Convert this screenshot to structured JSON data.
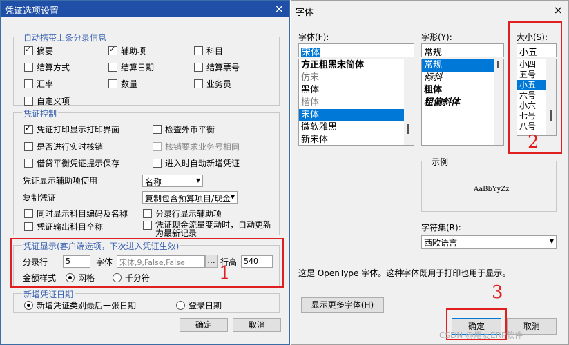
{
  "left_dialog": {
    "title": "凭证选项设置",
    "close_glyph": "×",
    "auto_group": {
      "legend": "自动携带上条分录信息",
      "items": [
        {
          "label": "摘要",
          "checked": true
        },
        {
          "label": "辅助项",
          "checked": true
        },
        {
          "label": "科目",
          "checked": false
        },
        {
          "label": "结算方式",
          "checked": false
        },
        {
          "label": "结算日期",
          "checked": false
        },
        {
          "label": "结算票号",
          "checked": false
        },
        {
          "label": "汇率",
          "checked": false
        },
        {
          "label": "数量",
          "checked": false
        },
        {
          "label": "业务员",
          "checked": false
        },
        {
          "label": "自定义项",
          "checked": false
        }
      ]
    },
    "control_group": {
      "legend": "凭证控制",
      "items": [
        {
          "label": "凭证打印显示打印界面",
          "checked": true
        },
        {
          "label": "检查外币平衡",
          "checked": false
        },
        {
          "label": "是否进行实时核销",
          "checked": false
        },
        {
          "label": "核销要求业务号相同",
          "checked": false,
          "disabled": true
        },
        {
          "label": "借贷平衡凭证提示保存",
          "checked": false
        },
        {
          "label": "进入时自动新增凭证",
          "checked": false
        }
      ],
      "aux_label": "凭证显示辅助项使用",
      "aux_value": "名称",
      "copy_label": "复制凭证",
      "copy_value": "复制包含预算项目/现金",
      "items2": [
        {
          "label": "同时显示科目编码及名称",
          "checked": false
        },
        {
          "label": "分录行显示辅助项",
          "checked": false
        },
        {
          "label": "凭证输出科目全称",
          "checked": false
        },
        {
          "label": "凭证现金流量变动时，自动更新为最新记录",
          "checked": false
        }
      ]
    },
    "display_group": {
      "legend": "凭证显示(客户端选项，下次进入凭证生效)",
      "rows_label": "分录行",
      "rows_value": "5",
      "font_label": "字体",
      "font_value": "宋体,9,False,False",
      "font_btn": "...",
      "height_label": "行高",
      "height_value": "540",
      "amount_label": "金额样式",
      "amount_options": [
        {
          "label": "网格",
          "checked": true
        },
        {
          "label": "千分符",
          "checked": false
        }
      ]
    },
    "date_group": {
      "legend": "新增凭证日期",
      "options": [
        {
          "label": "新增凭证类别最后一张日期",
          "checked": true
        },
        {
          "label": "登录日期",
          "checked": false
        }
      ]
    },
    "ok_label": "确定",
    "cancel_label": "取消",
    "annotation_1": "1"
  },
  "font_dialog": {
    "title": "字体",
    "close_glyph": "×",
    "font_label": "字体(F):",
    "font_value": "宋体",
    "fonts": [
      {
        "name": "方正粗黑宋简体",
        "selected": false
      },
      {
        "name": "仿宋",
        "selected": false
      },
      {
        "name": "黑体",
        "selected": false
      },
      {
        "name": "楷体",
        "selected": false
      },
      {
        "name": "宋体",
        "selected": true
      },
      {
        "name": "微软雅黑",
        "selected": false
      },
      {
        "name": "新宋体",
        "selected": false
      }
    ],
    "style_label": "字形(Y):",
    "style_value": "常规",
    "styles": [
      {
        "name": "常规",
        "selected": true
      },
      {
        "name": "倾斜",
        "selected": false
      },
      {
        "name": "粗体",
        "selected": false
      },
      {
        "name": "粗偏斜体",
        "selected": false
      }
    ],
    "size_label": "大小(S):",
    "size_value": "小五",
    "sizes": [
      {
        "name": "小四",
        "selected": false
      },
      {
        "name": "五号",
        "selected": false
      },
      {
        "name": "小五",
        "selected": true
      },
      {
        "name": "六号",
        "selected": false
      },
      {
        "name": "小六",
        "selected": false
      },
      {
        "name": "七号",
        "selected": false
      },
      {
        "name": "八号",
        "selected": false
      }
    ],
    "sample_label": "示例",
    "sample_text": "AaBbYyZz",
    "charset_label": "字符集(R):",
    "charset_value": "西欧语言",
    "info_text": "这是 OpenType 字体。这种字体既用于打印也用于显示。",
    "more_fonts_label": "显示更多字体(H)",
    "ok_label": "确定",
    "cancel_label": "取消",
    "annotation_2": "2",
    "annotation_3": "3",
    "watermark": "CSDN @用友ERP软件"
  },
  "colors": {
    "accent": "#0078d7",
    "title_bar": "#1f4fa7",
    "annotation": "#e02020",
    "legend": "#3a62b0"
  }
}
